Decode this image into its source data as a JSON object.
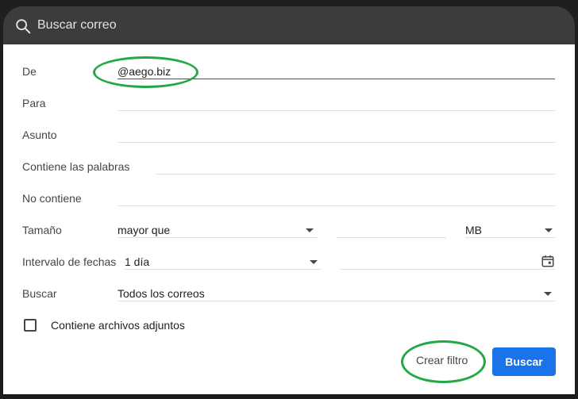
{
  "search": {
    "placeholder": "Buscar correo",
    "icon": "search-icon"
  },
  "form": {
    "from": {
      "label": "De",
      "value": "@aego.biz"
    },
    "to": {
      "label": "Para",
      "value": ""
    },
    "subject": {
      "label": "Asunto",
      "value": ""
    },
    "has_words": {
      "label": "Contiene las palabras",
      "value": ""
    },
    "not_has": {
      "label": "No contiene",
      "value": ""
    },
    "size": {
      "label": "Tamaño",
      "operator": "mayor que",
      "amount": "",
      "unit": "MB"
    },
    "date_range": {
      "label": "Intervalo de fechas",
      "value": "1 día",
      "date": ""
    },
    "search_in": {
      "label": "Buscar",
      "value": "Todos los correos"
    },
    "attachments": {
      "label": "Contiene archivos adjuntos",
      "checked": false
    }
  },
  "actions": {
    "create_filter": "Crear filtro",
    "search": "Buscar"
  },
  "colors": {
    "accent": "#1a73e8",
    "highlight_ellipse": "#22a845",
    "active_underline": "#0b57d0"
  }
}
